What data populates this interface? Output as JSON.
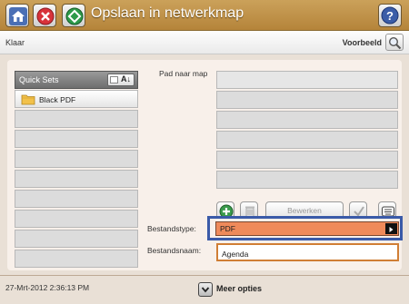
{
  "header": {
    "title": "Opslaan in netwerkmap",
    "home_icon": "home-icon",
    "stop_icon": "stop-icon",
    "start_icon": "start-icon",
    "help_icon": "help-icon"
  },
  "status": {
    "state": "Klaar",
    "preview_label": "Voorbeeld",
    "preview_icon": "magnifier-icon"
  },
  "quick_sets": {
    "header": "Quick Sets",
    "sort_label": "A↓",
    "items": [
      "Black PDF",
      "",
      "",
      "",
      "",
      "",
      "",
      "",
      ""
    ]
  },
  "path": {
    "label": "Pad naar map"
  },
  "actions": {
    "add_icon": "plus-icon",
    "delete_icon": "trash-icon",
    "edit_label": "Bewerken",
    "check_icon": "check-icon",
    "keyboard_icon": "keyboard-icon"
  },
  "file_type": {
    "label": "Bestandstype:",
    "value": "PDF"
  },
  "file_name": {
    "label": "Bestandsnaam:",
    "value": "Agenda"
  },
  "footer": {
    "timestamp": "27-Mrt-2012 2:36:13 PM",
    "more_options": "Meer opties"
  },
  "colors": {
    "title_bar": "#b98a40",
    "select_bg": "#ef8a5a",
    "highlight_border": "#3a5aa8",
    "input_border": "#d07e35",
    "panel_bg": "#f8f0ea"
  }
}
